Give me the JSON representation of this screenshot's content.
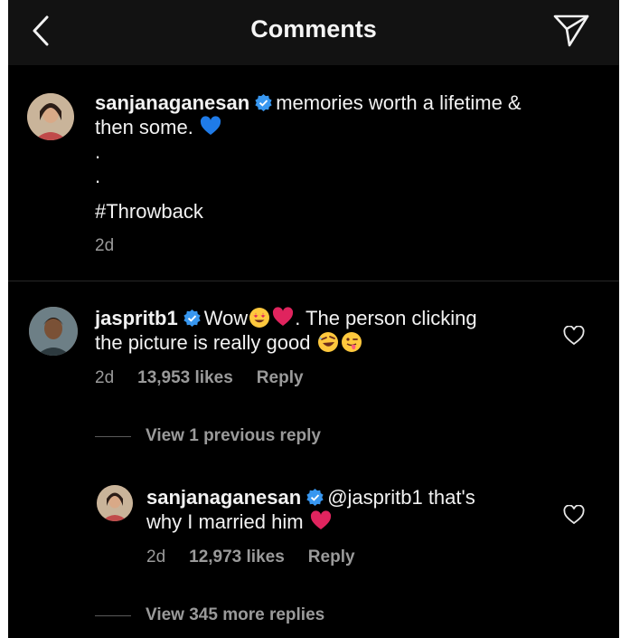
{
  "header": {
    "title": "Comments"
  },
  "caption": {
    "username": "sanjanaganesan",
    "line1_text": "memories worth a lifetime &",
    "line2_text": "then some.",
    "dot1": ".",
    "dot2": ".",
    "hashtag": "#Throwback",
    "time": "2d",
    "emoji": "blue-heart"
  },
  "comment": {
    "username": "jaspritb1",
    "text_a": "Wow",
    "text_b": ". The person clicking",
    "line2_text": "the picture is really good",
    "emojis": [
      "heart-eyes",
      "red-heart",
      "rofl",
      "winking-tongue"
    ],
    "time": "2d",
    "likes": "13,953 likes",
    "reply_label": "Reply"
  },
  "view_previous": {
    "label": "View 1 previous reply"
  },
  "reply": {
    "username": "sanjanaganesan",
    "mention": "@jaspritb1",
    "text_a": "that's",
    "line2_text": "why I married him",
    "emoji": "red-heart",
    "time": "2d",
    "likes": "12,973 likes",
    "reply_label": "Reply"
  },
  "view_more": {
    "label": "View 345 more replies"
  },
  "colors": {
    "background": "#000000",
    "header": "#121212",
    "text": "#f2f2f2",
    "muted": "#9a9a9a",
    "verified": "#3897f0",
    "heart": "#e0245e"
  }
}
